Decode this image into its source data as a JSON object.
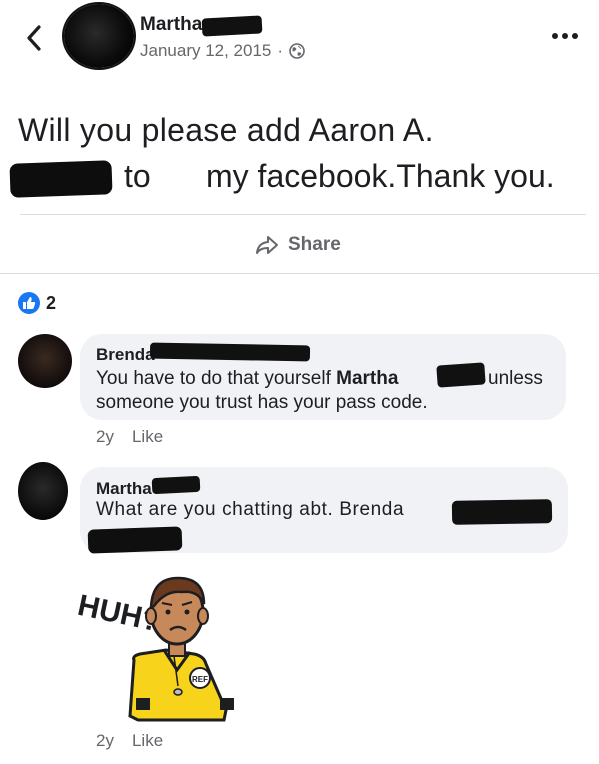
{
  "post": {
    "author": "Martha",
    "date": "January 12, 2015",
    "meta_separator": "·",
    "text_line1": "Will you please add Aaron A.",
    "text_line2a": "to",
    "text_line2b": "my facebook.Thank you.",
    "share_label": "Share",
    "reaction_count": "2"
  },
  "comments": [
    {
      "author": "Brenda",
      "text_part1": "You have to do that yourself ",
      "text_bold": "Martha",
      "text_part2": "unless",
      "text_line2": "someone you trust has your pass code.",
      "time": "2y",
      "like_label": "Like"
    },
    {
      "author": "Martha",
      "text": "What are you chatting abt. Brenda",
      "time": "2y",
      "like_label": "Like",
      "sticker_text": "HUH?",
      "sticker_badge": "REF"
    }
  ],
  "icons": {
    "back": "chevron-left-icon",
    "globe": "globe-icon",
    "more": "more-icon",
    "share": "share-icon",
    "like": "thumbs-up-icon"
  },
  "colors": {
    "accent": "#1877f2",
    "secondary_text": "#65676b",
    "bubble": "#f0f2f5"
  }
}
